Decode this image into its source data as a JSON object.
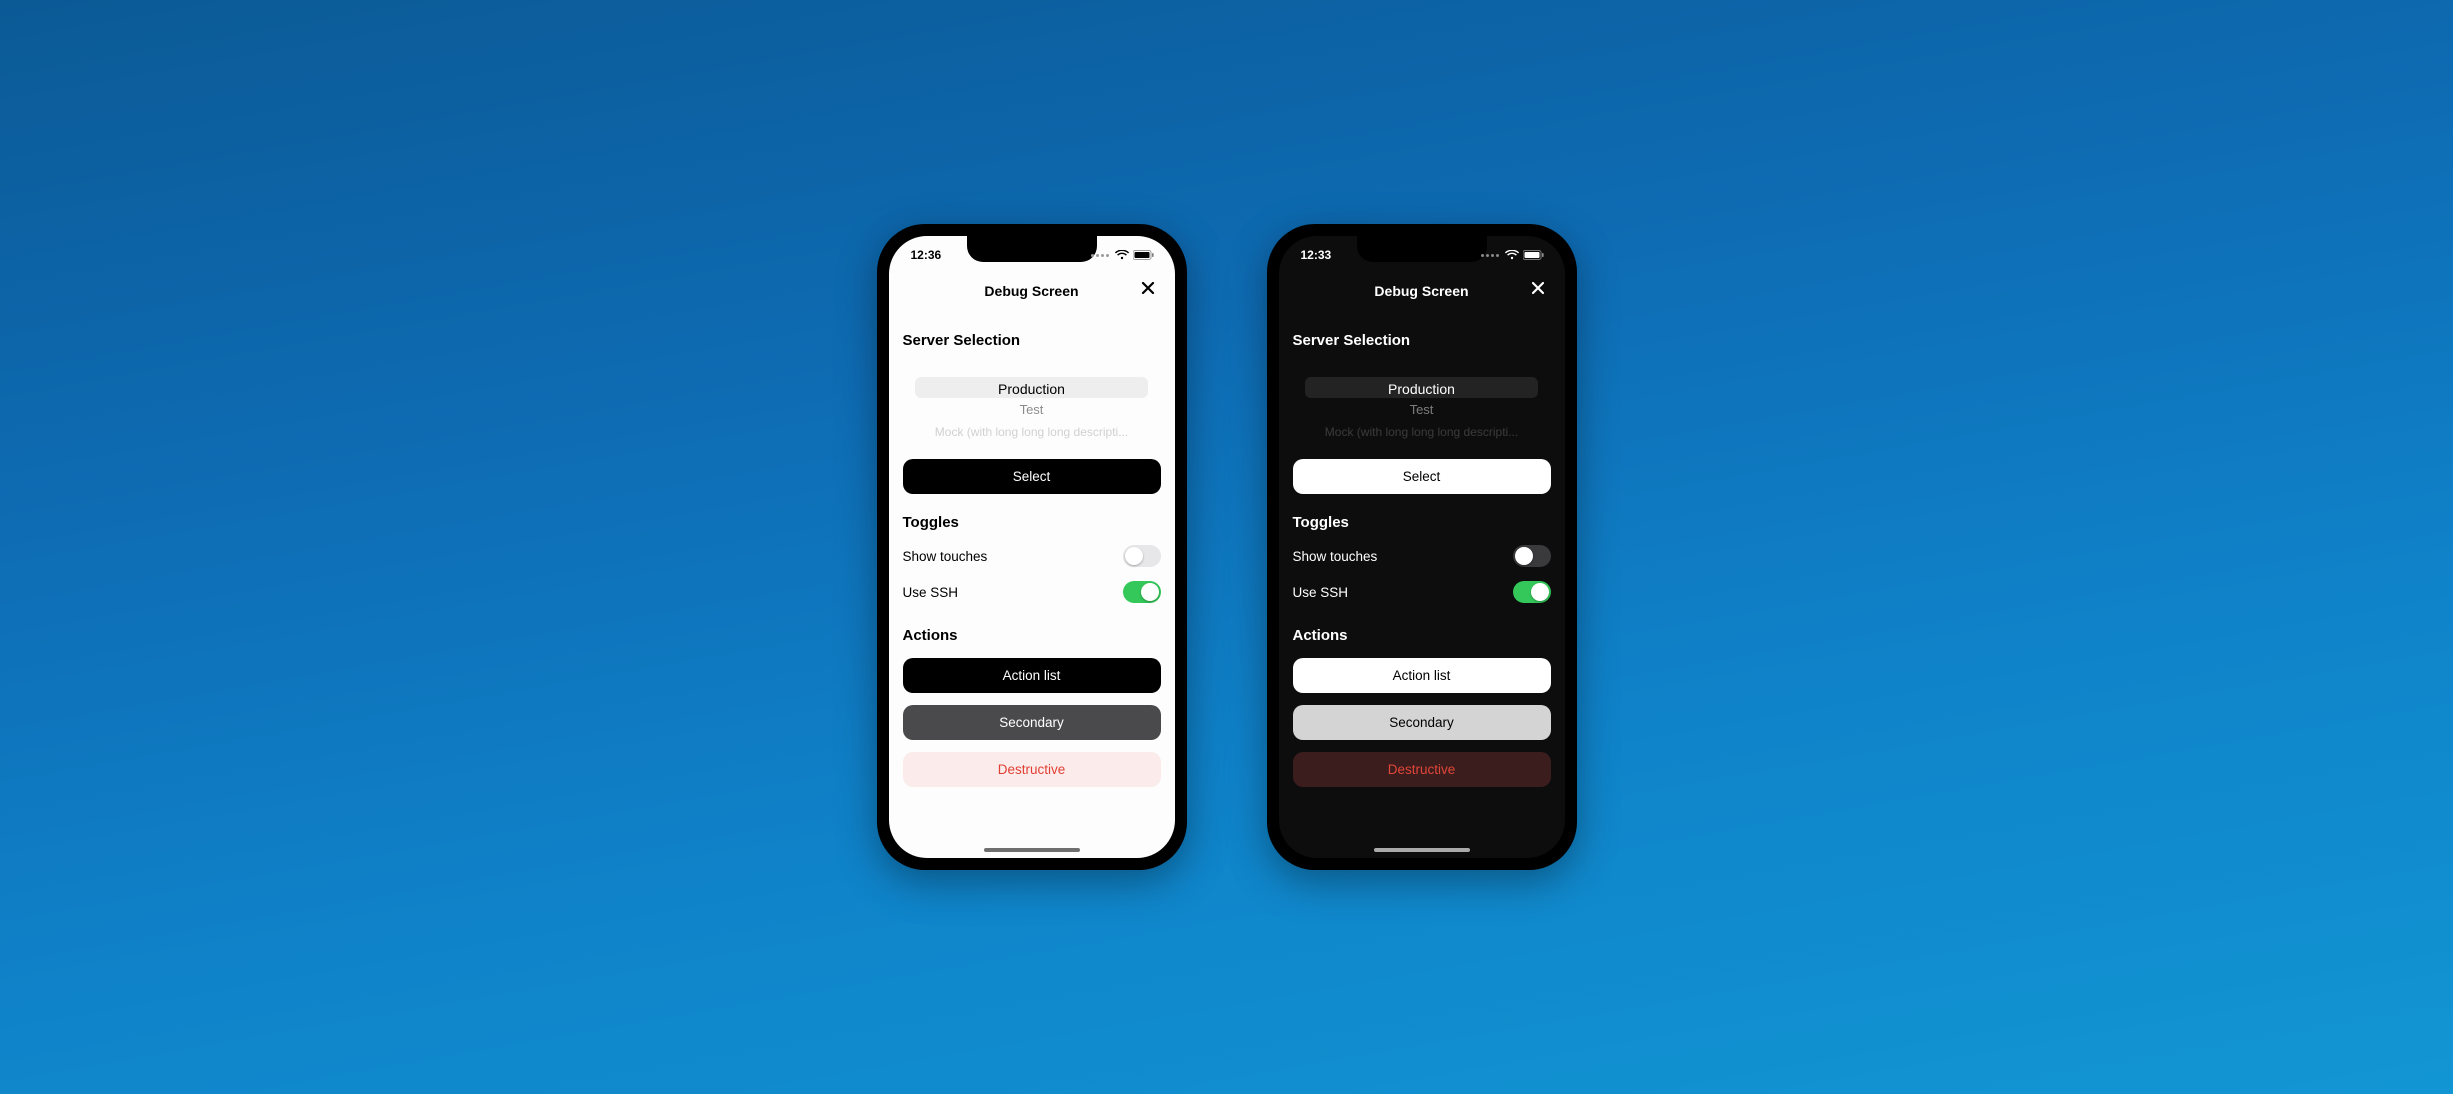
{
  "light": {
    "status": {
      "time": "12:36"
    },
    "nav": {
      "title": "Debug Screen"
    },
    "server_section": {
      "title": "Server Selection",
      "picker": {
        "selected": "Production",
        "option2": "Test",
        "option3": "Mock (with long long long descripti..."
      },
      "select_label": "Select"
    },
    "toggles_section": {
      "title": "Toggles",
      "items": [
        {
          "label": "Show touches",
          "on": false
        },
        {
          "label": "Use SSH",
          "on": true
        }
      ]
    },
    "actions_section": {
      "title": "Actions",
      "primary": "Action list",
      "secondary": "Secondary",
      "destructive": "Destructive"
    }
  },
  "dark": {
    "status": {
      "time": "12:33"
    },
    "nav": {
      "title": "Debug Screen"
    },
    "server_section": {
      "title": "Server Selection",
      "picker": {
        "selected": "Production",
        "option2": "Test",
        "option3": "Mock (with long long long descripti..."
      },
      "select_label": "Select"
    },
    "toggles_section": {
      "title": "Toggles",
      "items": [
        {
          "label": "Show touches",
          "on": false
        },
        {
          "label": "Use SSH",
          "on": true
        }
      ]
    },
    "actions_section": {
      "title": "Actions",
      "primary": "Action list",
      "secondary": "Secondary",
      "destructive": "Destructive"
    }
  },
  "colors": {
    "accent_green": "#34c759",
    "destructive": "#e23f34"
  }
}
